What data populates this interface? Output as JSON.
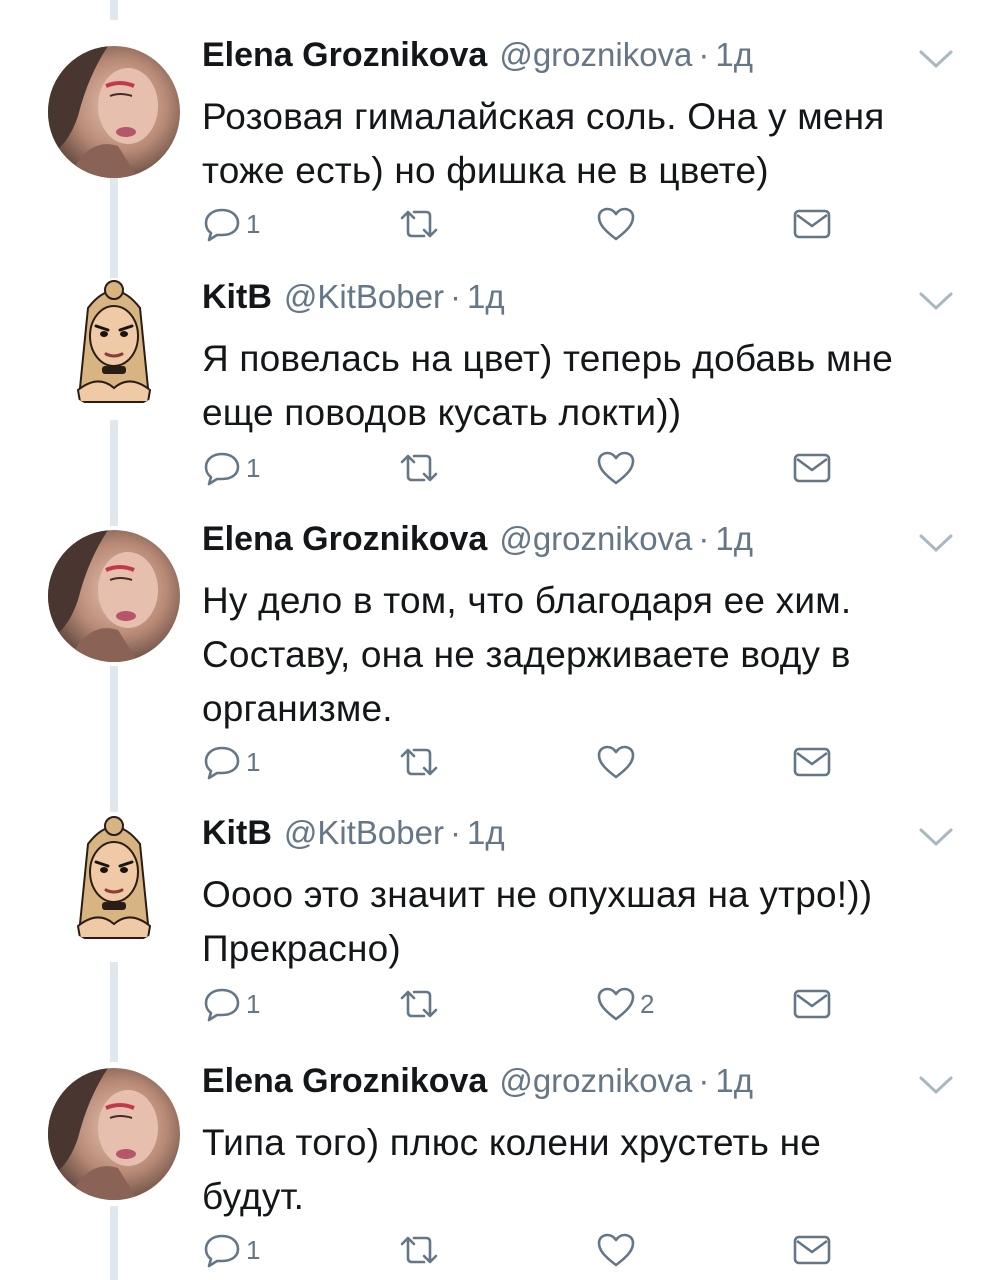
{
  "tweets": [
    {
      "name": "Elena Groznikova",
      "handle": "@groznikova",
      "time": "1д",
      "lines": [
        "Розовая гималайская соль. Она у меня",
        "тоже есть) но фишка не в цвете)"
      ],
      "reply_count": "1",
      "like_count": "",
      "avatar": "photo-avatar"
    },
    {
      "name": "KitB",
      "handle": "@KitBober",
      "time": "1д",
      "lines": [
        "Я повелась на цвет) теперь добавь мне",
        "еще поводов кусать локти))"
      ],
      "reply_count": "1",
      "like_count": "",
      "avatar": "cartoon-avatar"
    },
    {
      "name": "Elena Groznikova",
      "handle": "@groznikova",
      "time": "1д",
      "lines": [
        "Ну дело в том, что благодаря ее хим.",
        "Составу, она не задерживаете воду в",
        "организме."
      ],
      "reply_count": "1",
      "like_count": "",
      "avatar": "photo-avatar"
    },
    {
      "name": "KitB",
      "handle": "@KitBober",
      "time": "1д",
      "lines": [
        "Оооо это значит не опухшая на утро!))",
        "Прекрасно)"
      ],
      "reply_count": "1",
      "like_count": "2",
      "avatar": "cartoon-avatar"
    },
    {
      "name": "Elena Groznikova",
      "handle": "@groznikova",
      "time": "1д",
      "lines": [
        "Типа того) плюс колени хрустеть не",
        "будут."
      ],
      "reply_count": "1",
      "like_count": "",
      "avatar": "photo-avatar"
    }
  ],
  "separator": "·",
  "icons": {
    "reply": "reply-icon",
    "retweet": "retweet-icon",
    "like": "heart-icon",
    "dm": "envelope-icon",
    "more": "chevron-down-icon"
  },
  "colors": {
    "text": "#14171a",
    "secondary": "#657786",
    "thread_line": "#e1e8ed"
  }
}
